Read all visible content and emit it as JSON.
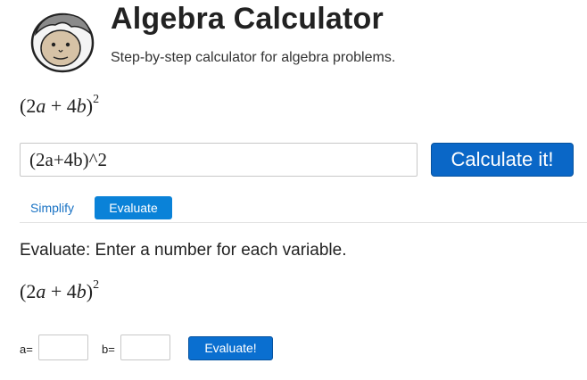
{
  "header": {
    "title": "Algebra Calculator",
    "subtitle": "Step-by-step calculator for algebra problems."
  },
  "expression_display": {
    "open": "(2",
    "var1": "a",
    "plus": " + 4",
    "var2": "b",
    "close": ")",
    "exponent": "2"
  },
  "input": {
    "value": "(2a+4b)^2"
  },
  "calculate_button": "Calculate it!",
  "tabs": [
    {
      "label": "Simplify",
      "active": false
    },
    {
      "label": "Evaluate",
      "active": true
    }
  ],
  "evaluate": {
    "instruction": "Evaluate: Enter a number for each variable.",
    "variables": [
      {
        "label": "a=",
        "value": ""
      },
      {
        "label": "b=",
        "value": ""
      }
    ],
    "button": "Evaluate!"
  },
  "colors": {
    "accent": "#0a67c7",
    "tab_active": "#0a82d8",
    "link": "#1a73c4"
  }
}
